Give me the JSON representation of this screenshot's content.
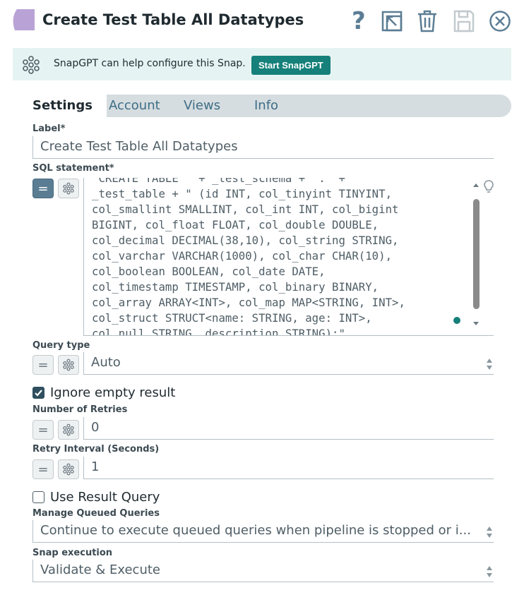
{
  "header": {
    "title": "Create Test Table All Datatypes",
    "snap_color": "#b9a3d6",
    "icons": [
      "help-icon",
      "export-icon",
      "delete-icon",
      "save-icon",
      "close-icon"
    ]
  },
  "snapgpt": {
    "text": "SnapGPT can help configure this Snap.",
    "button_label": "Start SnapGPT",
    "button_color": "#16807a",
    "bar_color": "#e5f4f2"
  },
  "tabs": [
    {
      "label": "Settings",
      "active": true
    },
    {
      "label": "Account",
      "active": false
    },
    {
      "label": "Views",
      "active": false
    },
    {
      "label": "Info",
      "active": false
    }
  ],
  "fields": {
    "label": {
      "title": "Label*",
      "value": "Create Test Table All Datatypes"
    },
    "sql_statement": {
      "title": "SQL statement*",
      "lines": [
        "\"CREATE TABLE \" + _test_schema + \".\" +",
        "_test_table + \" (id INT, col_tinyint TINYINT,",
        "col_smallint SMALLINT, col_int INT, col_bigint",
        "BIGINT, col_float FLOAT, col_double DOUBLE,",
        "col_decimal DECIMAL(38,10), col_string STRING,",
        "col_varchar VARCHAR(1000), col_char CHAR(10),",
        "col_boolean BOOLEAN, col_date DATE,",
        "col_timestamp TIMESTAMP, col_binary BINARY,",
        "col_array ARRAY<INT>, col_map MAP<STRING, INT>,",
        "col_struct STRUCT<name: STRING, age: INT>,",
        "col_null STRING, description STRING);\""
      ],
      "expression_enabled": true
    },
    "query_type": {
      "title": "Query type",
      "value": "Auto"
    },
    "ignore_empty_result": {
      "label": "Ignore empty result",
      "checked": true
    },
    "number_of_retries": {
      "title": "Number of Retries",
      "value": "0"
    },
    "retry_interval": {
      "title": "Retry Interval (Seconds)",
      "value": "1"
    },
    "use_result_query": {
      "label": "Use Result Query",
      "checked": false
    },
    "manage_queued_queries": {
      "title": "Manage Queued Queries",
      "value": "Continue to execute queued queries when pipeline is stopped or i..."
    },
    "snap_execution": {
      "title": "Snap execution",
      "value": "Validate & Execute"
    }
  },
  "buttons": {
    "expression_toggle": "=",
    "accent": "#16807a"
  }
}
